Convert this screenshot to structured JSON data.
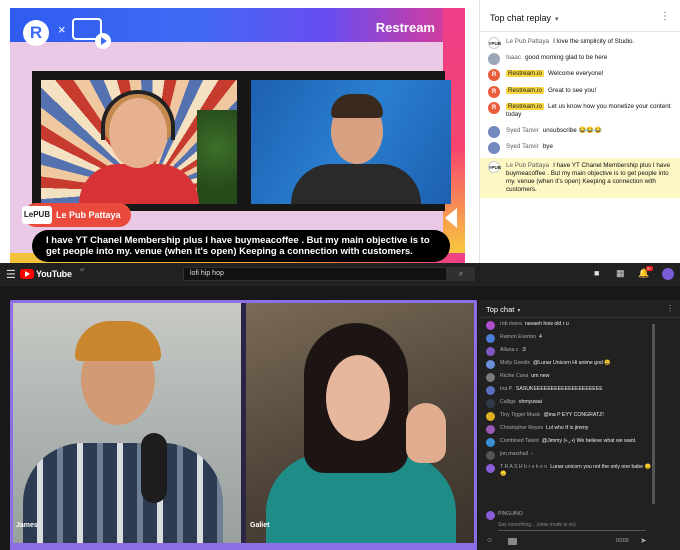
{
  "top": {
    "brand": "Restream",
    "stage": {
      "name_tag": "Le Pub Pattaya",
      "name_logo": "LePUB",
      "banner": "I have YT Chanel Membership plus I have buymeacoffee . But my main objective is to get people into my. venue (when it's open) Keeping a connection with customers.",
      "times_glyph": "×",
      "logo_letter": "R"
    },
    "replay": {
      "title": "Top chat replay",
      "caret": "▾",
      "kebab": "⋮",
      "messages": [
        {
          "author": "Le Pub Pattaya",
          "text": "I love the simplicity of Studio.",
          "avatar": "pub",
          "avatar_text": "#PUB"
        },
        {
          "author": "Isaac",
          "text": "good morning glad to be here",
          "avatar": "g",
          "avatar_text": ""
        },
        {
          "author": "Restream.io",
          "text": "Welcome everyone!",
          "avatar": "r",
          "avatar_text": "R",
          "tag": true
        },
        {
          "author": "Restream.io",
          "text": "Great to see you!",
          "avatar": "r",
          "avatar_text": "R",
          "tag": true
        },
        {
          "author": "Restream.io",
          "text": "Let us know how you monetize your content today",
          "avatar": "r",
          "avatar_text": "R",
          "tag": true
        },
        {
          "author": "Syed Tanvir",
          "text": "unsubscribe 😂😂😂",
          "avatar": "p",
          "avatar_text": ""
        },
        {
          "author": "Syed Tanvir",
          "text": "bye",
          "avatar": "p",
          "avatar_text": ""
        },
        {
          "author": "Le Pub Pattaya",
          "text": "I have YT Chanel Membership plus I have buymeacoffee . But my main objective is to get people into my. venue (when it's open) Keeping a connection with customers.",
          "avatar": "pub",
          "avatar_text": "#PUB",
          "highlight": true
        }
      ]
    }
  },
  "yt": {
    "wordmark": "YouTube",
    "country": "AT",
    "search_value": "lofi hip hop",
    "search_icon": "search-icon",
    "menu_icon": "☰",
    "search_glyph": "⌕",
    "icons": {
      "camera": "■",
      "apps": "▦",
      "bell": "🔔"
    },
    "bell_count": "9+",
    "player": {
      "left_label": "James",
      "right_label": "Galiet"
    },
    "chat": {
      "title": "Top chat",
      "caret": "▾",
      "kebab": "⋮",
      "messages": [
        {
          "author": "rob rivera",
          "text": "navaeh how old r u",
          "color": "#b04fd0"
        },
        {
          "author": "Ramon Everton",
          "text": "4",
          "color": "#4a7cd8"
        },
        {
          "author": "Allana c",
          "text": ":3",
          "color": "#7e57c2"
        },
        {
          "author": "Molly Greells",
          "text": "@Lunar Unicorn Hi anime god 😀",
          "color": "#6a8fd8"
        },
        {
          "author": "Richie Cuna",
          "text": "um new",
          "color": "#7b7b7b"
        },
        {
          "author": "Ina P.",
          "text": "SASUKEEEEEEEEEEEEEEEEEEEE",
          "color": "#5f6fbf"
        },
        {
          "author": "Calligs",
          "text": "ohmyuwai",
          "color": "#2f3a4a"
        },
        {
          "author": "Tiny Tigger Music",
          "text": "@ina P EYY CONGRATZ!",
          "color": "#e0b020"
        },
        {
          "author": "Christopher Reyes",
          "text": "Lol who tf is jimmy",
          "color": "#9b59b6"
        },
        {
          "author": "Combined Talent",
          "text": "@Jimmy (•◡•) We believe what we want.",
          "color": "#3a8fd8"
        },
        {
          "author": "jon.marshall",
          "text": "-",
          "color": "#555555"
        },
        {
          "author": "T R A S H b r o k e n",
          "text": "Lunar unicorn you not the only one babe 😞😞",
          "color": "#8b5bd8"
        }
      ],
      "me_name": "PINGUINO",
      "input_placeholder": "Say something... (slow mode is on)",
      "count": "0/200",
      "send": "➤",
      "emoji_icon": "☺",
      "money_icon": "money-icon"
    }
  }
}
